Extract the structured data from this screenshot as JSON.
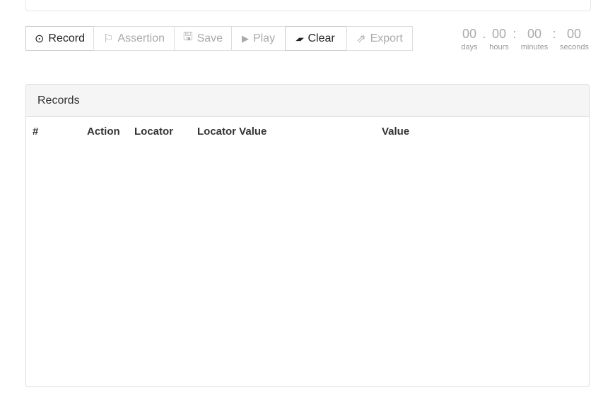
{
  "toolbar": {
    "buttons": [
      {
        "label": "Record",
        "icon": "record-icon",
        "glyph": "⊙",
        "active": true
      },
      {
        "label": "Assertion",
        "icon": "flag-icon",
        "glyph": "⚐",
        "active": false
      },
      {
        "label": "Save",
        "icon": "save-icon",
        "glyph": "🖫",
        "active": false
      },
      {
        "label": "Play",
        "icon": "play-icon",
        "glyph": "▶",
        "active": false
      },
      {
        "label": "Clear",
        "icon": "eraser-icon",
        "glyph": "▰",
        "active": true
      },
      {
        "label": "Export",
        "icon": "export-icon",
        "glyph": "⇗",
        "active": false
      }
    ]
  },
  "timer": {
    "days": "00",
    "hours": "00",
    "minutes": "00",
    "seconds": "00",
    "sep1": ".",
    "sep2": ":",
    "sep3": ":",
    "labels": {
      "days": "days",
      "hours": "hours",
      "minutes": "minutes",
      "seconds": "seconds"
    }
  },
  "records": {
    "title": "Records",
    "columns": [
      "#",
      "Action",
      "Locator",
      "Locator Value",
      "Value"
    ],
    "rows": []
  }
}
